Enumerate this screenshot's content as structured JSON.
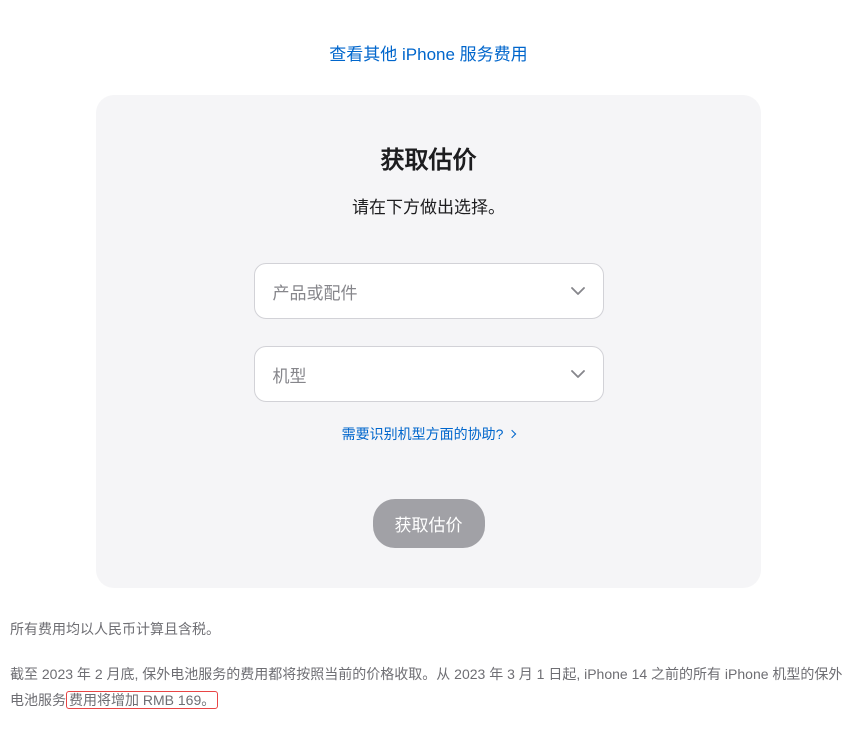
{
  "topLink": {
    "label": "查看其他 iPhone 服务费用"
  },
  "card": {
    "title": "获取估价",
    "subtitle": "请在下方做出选择。",
    "select1": {
      "placeholder": "产品或配件"
    },
    "select2": {
      "placeholder": "机型"
    },
    "helpLink": "需要识别机型方面的协助?",
    "submitButton": "获取估价"
  },
  "footer": {
    "line1": "所有费用均以人民币计算且含税。",
    "line2_part1": "截至 2023 年 2 月底, 保外电池服务的费用都将按照当前的价格收取。从 2023 年 3 月 1 日起, iPhone 14 之前的所有 iPhone 机型的保外电池服务",
    "line2_highlight": "费用将增加 RMB 169。"
  }
}
